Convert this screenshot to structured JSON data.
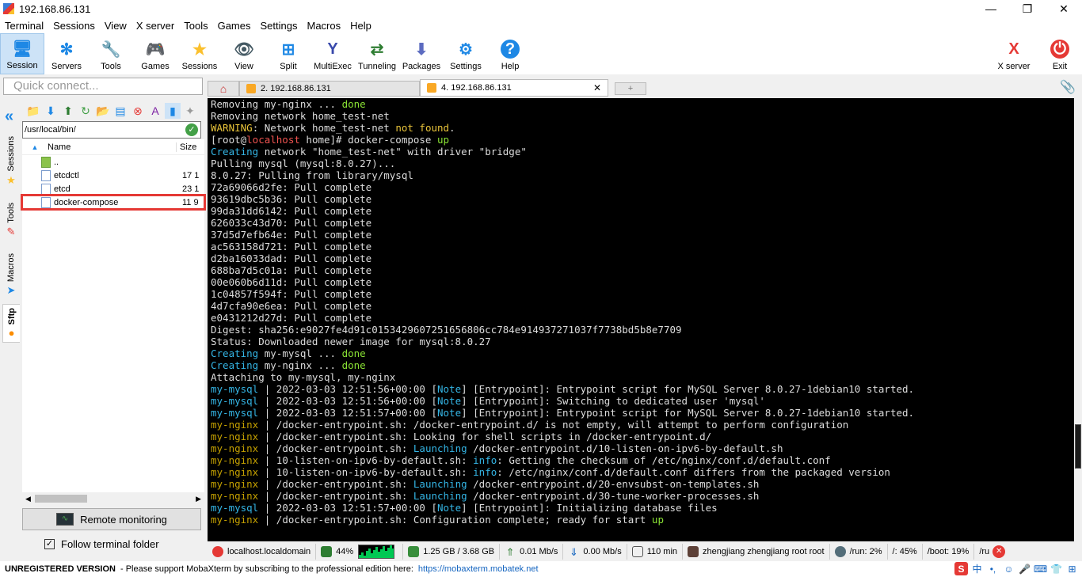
{
  "window": {
    "title": "192.168.86.131",
    "controls": [
      "—",
      "❐",
      "✕"
    ]
  },
  "menu": [
    "Terminal",
    "Sessions",
    "View",
    "X server",
    "Tools",
    "Games",
    "Settings",
    "Macros",
    "Help"
  ],
  "toolbar": {
    "items": [
      {
        "label": "Session",
        "icon": "monitor-icon",
        "glyph": "🖥"
      },
      {
        "label": "Servers",
        "icon": "servers-icon",
        "glyph": "✻"
      },
      {
        "label": "Tools",
        "icon": "tools-icon",
        "glyph": "🔧"
      },
      {
        "label": "Games",
        "icon": "games-icon",
        "glyph": "🎮"
      },
      {
        "label": "Sessions",
        "icon": "star-icon",
        "glyph": "★"
      },
      {
        "label": "View",
        "icon": "view-icon",
        "glyph": "👁"
      },
      {
        "label": "Split",
        "icon": "split-icon",
        "glyph": "⊞"
      },
      {
        "label": "MultiExec",
        "icon": "multiexec-icon",
        "glyph": "Y"
      },
      {
        "label": "Tunneling",
        "icon": "tunneling-icon",
        "glyph": "⇄"
      },
      {
        "label": "Packages",
        "icon": "packages-icon",
        "glyph": "⬇"
      },
      {
        "label": "Settings",
        "icon": "gears-icon",
        "glyph": "⚙"
      },
      {
        "label": "Help",
        "icon": "help-icon",
        "glyph": "?"
      }
    ],
    "right": [
      {
        "label": "X server",
        "icon": "x-server-icon",
        "glyph": "X"
      },
      {
        "label": "Exit",
        "icon": "power-icon",
        "glyph": "⏻"
      }
    ]
  },
  "quick_connect": {
    "placeholder": "Quick connect..."
  },
  "tabs": [
    {
      "label": "2. 192.168.86.131",
      "active": false
    },
    {
      "label": "4. 192.168.86.131",
      "active": true
    }
  ],
  "side_tabs": [
    "Sessions",
    "Tools",
    "Macros",
    "Sftp"
  ],
  "sftp": {
    "path": "/usr/local/bin/",
    "columns": {
      "name": "Name",
      "size": "Size"
    },
    "files": [
      {
        "name": "..",
        "size": "",
        "type": "parent"
      },
      {
        "name": "etcdctl",
        "size": "17 1",
        "type": "file"
      },
      {
        "name": "etcd",
        "size": "23 1",
        "type": "file"
      },
      {
        "name": "docker-compose",
        "size": "11 9",
        "type": "file",
        "highlighted": true
      }
    ],
    "remote_monitoring": "Remote monitoring",
    "follow_terminal": "Follow terminal folder"
  },
  "terminal": {
    "lines": [
      [
        [
          "Removing my-nginx ... ",
          ""
        ],
        [
          "done",
          "green"
        ]
      ],
      [
        [
          "Removing network home_test-net",
          ""
        ]
      ],
      [
        [
          "WARNING",
          "yellow"
        ],
        [
          ": Network home_test-net ",
          ""
        ],
        [
          "not found",
          "yellow"
        ],
        [
          ".",
          ""
        ]
      ],
      [
        [
          "[root@",
          ""
        ],
        [
          "localhost",
          "red"
        ],
        [
          " home]# docker-compose ",
          ""
        ],
        [
          "up",
          "green"
        ]
      ],
      [
        [
          "Creating",
          "cyan"
        ],
        [
          " network \"home_test-net\" with driver \"bridge\"",
          ""
        ]
      ],
      [
        [
          "Pulling mysql (mysql:8.0.27)...",
          ""
        ]
      ],
      [
        [
          "8.0.27: Pulling from library/mysql",
          ""
        ]
      ],
      [
        [
          "72a69066d2fe: Pull complete",
          ""
        ]
      ],
      [
        [
          "93619dbc5b36: Pull complete",
          ""
        ]
      ],
      [
        [
          "99da31dd6142: Pull complete",
          ""
        ]
      ],
      [
        [
          "626033c43d70: Pull complete",
          ""
        ]
      ],
      [
        [
          "37d5d7efb64e: Pull complete",
          ""
        ]
      ],
      [
        [
          "ac563158d721: Pull complete",
          ""
        ]
      ],
      [
        [
          "d2ba16033dad: Pull complete",
          ""
        ]
      ],
      [
        [
          "688ba7d5c01a: Pull complete",
          ""
        ]
      ],
      [
        [
          "00e060b6d11d: Pull complete",
          ""
        ]
      ],
      [
        [
          "1c04857f594f: Pull complete",
          ""
        ]
      ],
      [
        [
          "4d7cfa90e6ea: Pull complete",
          ""
        ]
      ],
      [
        [
          "e0431212d27d: Pull complete",
          ""
        ]
      ],
      [
        [
          "Digest: sha256:e9027fe4d91c0153429607251656806cc784e914937271037f7738bd5b8e7709",
          ""
        ]
      ],
      [
        [
          "Status: Downloaded newer image for mysql:8.0.27",
          ""
        ]
      ],
      [
        [
          "Creating",
          "cyan"
        ],
        [
          " my-mysql ... ",
          ""
        ],
        [
          "done",
          "green"
        ]
      ],
      [
        [
          "Creating",
          "cyan"
        ],
        [
          " my-nginx ... ",
          ""
        ],
        [
          "done",
          "green"
        ]
      ],
      [
        [
          "Attaching to my-mysql, my-nginx",
          ""
        ]
      ],
      [
        [
          "my-mysql",
          "cyan"
        ],
        [
          " | 2022-03-03 12:51:56+00:00 [",
          ""
        ],
        [
          "Note",
          "cyan"
        ],
        [
          "] [Entrypoint]: Entrypoint script for MySQL Server 8.0.27-1debian10 started.",
          ""
        ]
      ],
      [
        [
          "my-mysql",
          "cyan"
        ],
        [
          " | 2022-03-03 12:51:56+00:00 [",
          ""
        ],
        [
          "Note",
          "cyan"
        ],
        [
          "] [Entrypoint]: Switching to dedicated user 'mysql'",
          ""
        ]
      ],
      [
        [
          "my-mysql",
          "cyan"
        ],
        [
          " | 2022-03-03 12:51:57+00:00 [",
          ""
        ],
        [
          "Note",
          "cyan"
        ],
        [
          "] [Entrypoint]: Entrypoint script for MySQL Server 8.0.27-1debian10 started.",
          ""
        ]
      ],
      [
        [
          "my-nginx",
          "olive"
        ],
        [
          " | /docker-entrypoint.sh: /docker-entrypoint.d/ is not empty, will attempt to perform configuration",
          ""
        ]
      ],
      [
        [
          "my-nginx",
          "olive"
        ],
        [
          " | /docker-entrypoint.sh: Looking for shell scripts in /docker-entrypoint.d/",
          ""
        ]
      ],
      [
        [
          "my-nginx",
          "olive"
        ],
        [
          " | /docker-entrypoint.sh: ",
          ""
        ],
        [
          "Launching",
          "cyan"
        ],
        [
          " /docker-entrypoint.d/10-listen-on-ipv6-by-default.sh",
          ""
        ]
      ],
      [
        [
          "my-nginx",
          "olive"
        ],
        [
          " | 10-listen-on-ipv6-by-default.sh: ",
          ""
        ],
        [
          "info",
          "cyan"
        ],
        [
          ": Getting the checksum of /etc/nginx/conf.d/default.conf",
          ""
        ]
      ],
      [
        [
          "my-nginx",
          "olive"
        ],
        [
          " | 10-listen-on-ipv6-by-default.sh: ",
          ""
        ],
        [
          "info",
          "cyan"
        ],
        [
          ": /etc/nginx/conf.d/default.conf differs from the packaged version",
          ""
        ]
      ],
      [
        [
          "my-nginx",
          "olive"
        ],
        [
          " | /docker-entrypoint.sh: ",
          ""
        ],
        [
          "Launching",
          "cyan"
        ],
        [
          " /docker-entrypoint.d/20-envsubst-on-templates.sh",
          ""
        ]
      ],
      [
        [
          "my-nginx",
          "olive"
        ],
        [
          " | /docker-entrypoint.sh: ",
          ""
        ],
        [
          "Launching",
          "cyan"
        ],
        [
          " /docker-entrypoint.d/30-tune-worker-processes.sh",
          ""
        ]
      ],
      [
        [
          "my-mysql",
          "cyan"
        ],
        [
          " | 2022-03-03 12:51:57+00:00 [",
          ""
        ],
        [
          "Note",
          "cyan"
        ],
        [
          "] [Entrypoint]: Initializing database files",
          ""
        ]
      ],
      [
        [
          "my-nginx",
          "olive"
        ],
        [
          " | /docker-entrypoint.sh: Configuration complete; ready for start ",
          ""
        ],
        [
          "up",
          "green"
        ]
      ]
    ]
  },
  "status": {
    "host": "localhost.localdomain",
    "cpu": "44%",
    "memory": "1.25 GB / 3.68 GB",
    "upload": "0.01 Mb/s",
    "download": "0.00 Mb/s",
    "uptime": "110 min",
    "users": "zhengjiang  zhengjiang  root  root",
    "disk_run": "/run: 2%",
    "disk_root": "/: 45%",
    "disk_boot": "/boot: 19%",
    "disk_more": "/ru"
  },
  "footer": {
    "unregistered": "UNREGISTERED VERSION",
    "message": "-  Please support MobaXterm by subscribing to the professional edition here:",
    "link": "https://mobaxterm.mobatek.net"
  },
  "colors": {
    "green": "#8ae234",
    "cyan": "#34b5e5",
    "yellow": "#e9c43a",
    "red": "#ef5350",
    "olive": "#c4a000",
    "highlight": "#e53935"
  }
}
